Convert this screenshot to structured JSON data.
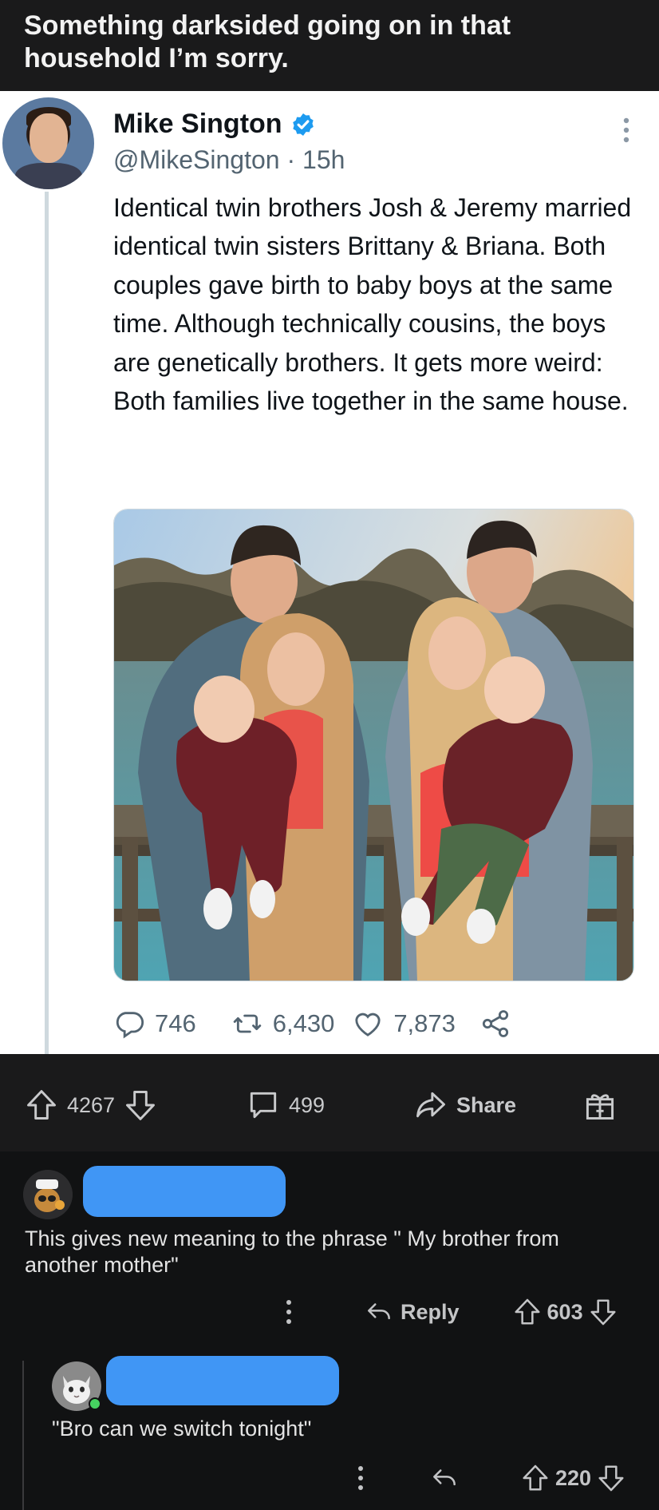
{
  "post": {
    "title": "Something darksided going on in that household I’m sorry."
  },
  "tweet": {
    "name": "Mike Sington",
    "handle": "@MikeSington",
    "separator": "·",
    "time": "15h",
    "text": "Identical twin brothers Josh & Jeremy married identical twin sisters Brittany & Briana. Both couples gave birth to baby boys at the same time. Although technically cousins, the boys are genetically brothers. It gets more weird: Both families live together in the same house.",
    "replies": "746",
    "retweets": "6,430",
    "likes": "7,873",
    "verified_color": "#1d9bf0"
  },
  "post_actions": {
    "upvotes": "4267",
    "comments": "499",
    "share_label": "Share"
  },
  "comments": [
    {
      "text": "This gives new meaning to the phrase \" My brother from another mother\"",
      "reply_label": "Reply",
      "votes": "603"
    },
    {
      "text": "\"Bro can we switch tonight\"",
      "votes": "220"
    }
  ],
  "colors": {
    "redaction": "#4096f5",
    "background": "#111213",
    "online": "#46d160"
  }
}
